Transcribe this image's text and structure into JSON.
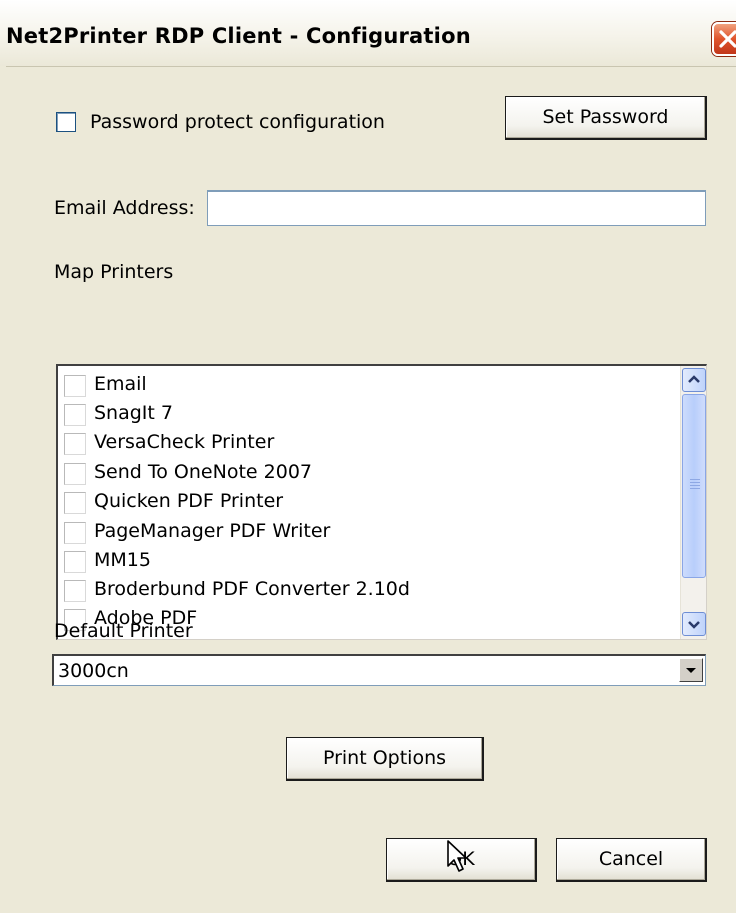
{
  "window": {
    "title": "Net2Printer RDP Client - Configuration"
  },
  "protect": {
    "label": "Password protect configuration",
    "checked": false
  },
  "set_password_label": "Set Password",
  "email": {
    "label": "Email Address:",
    "value": ""
  },
  "map_printers": {
    "label": "Map Printers",
    "items": [
      "Email",
      "SnagIt 7",
      "VersaCheck Printer",
      "Send To OneNote 2007",
      "Quicken PDF Printer",
      "PageManager PDF Writer",
      "MM15",
      "Broderbund PDF Converter 2.10d",
      "Adobe PDF"
    ]
  },
  "default_printer": {
    "label": "Default Printer",
    "value": "3000cn"
  },
  "print_options_label": "Print Options",
  "ok_label": "OK",
  "cancel_label": "Cancel"
}
